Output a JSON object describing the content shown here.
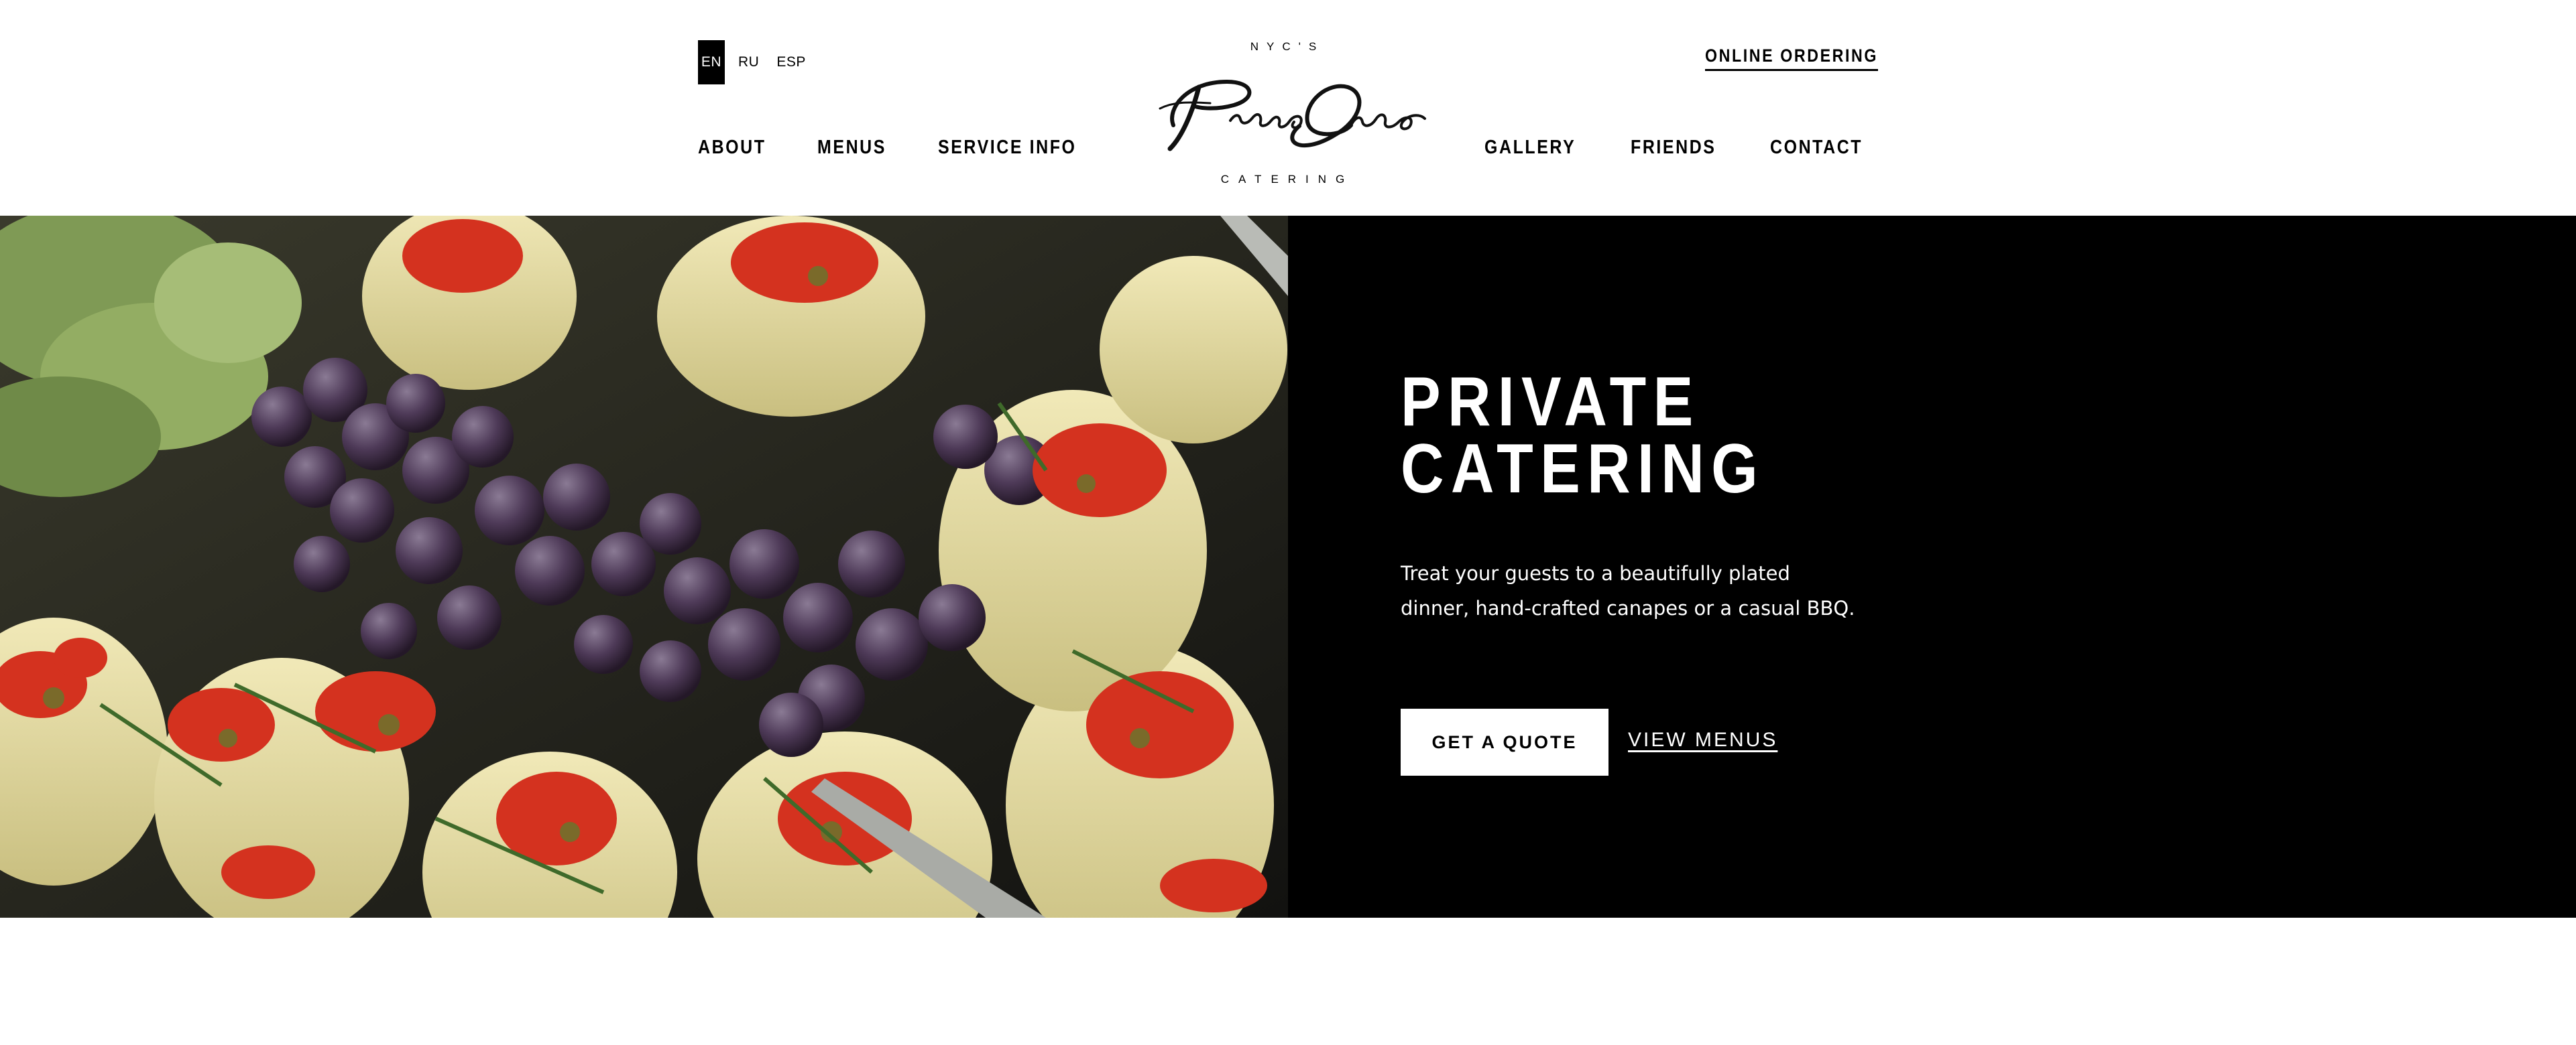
{
  "header": {
    "languages": [
      {
        "label": "EN",
        "active": true
      },
      {
        "label": "RU",
        "active": false
      },
      {
        "label": "ESP",
        "active": false
      }
    ],
    "online_ordering": "ONLINE ORDERING",
    "nav_left": [
      {
        "label": "ABOUT"
      },
      {
        "label": "MENUS"
      },
      {
        "label": "SERVICE INFO"
      }
    ],
    "nav_right": [
      {
        "label": "GALLERY"
      },
      {
        "label": "FRIENDS"
      },
      {
        "label": "CONTACT"
      }
    ],
    "logo": {
      "top": "NYC'S",
      "script": "PrimeOne",
      "bottom": "CATERING"
    }
  },
  "hero": {
    "title_line1": "PRIVATE",
    "title_line2": "CATERING",
    "description": "Treat your guests to a beautifully plated dinner, hand-crafted canapes or a casual BBQ.",
    "quote_button": "GET A QUOTE",
    "view_menus": "VIEW MENUS",
    "panel_color": "#000000"
  }
}
